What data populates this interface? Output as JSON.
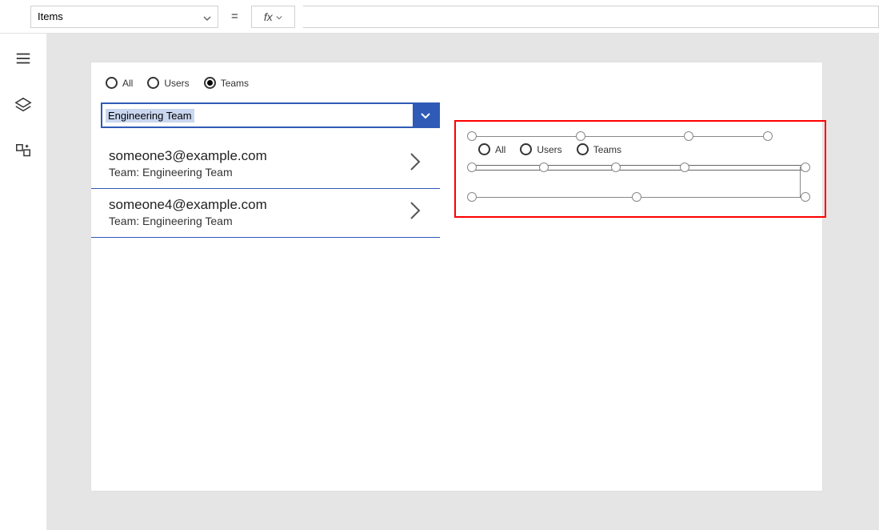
{
  "topbar": {
    "property": "Items",
    "equals": "="
  },
  "canvas": {
    "filter1": {
      "all": "All",
      "users": "Users",
      "teams": "Teams"
    },
    "dropdown_value": "Engineering Team",
    "list": [
      {
        "primary": "someone3@example.com",
        "secondary": "Team: Engineering Team"
      },
      {
        "primary": "someone4@example.com",
        "secondary": "Team: Engineering Team"
      }
    ],
    "filter2": {
      "all": "All",
      "users": "Users",
      "teams": "Teams"
    }
  }
}
